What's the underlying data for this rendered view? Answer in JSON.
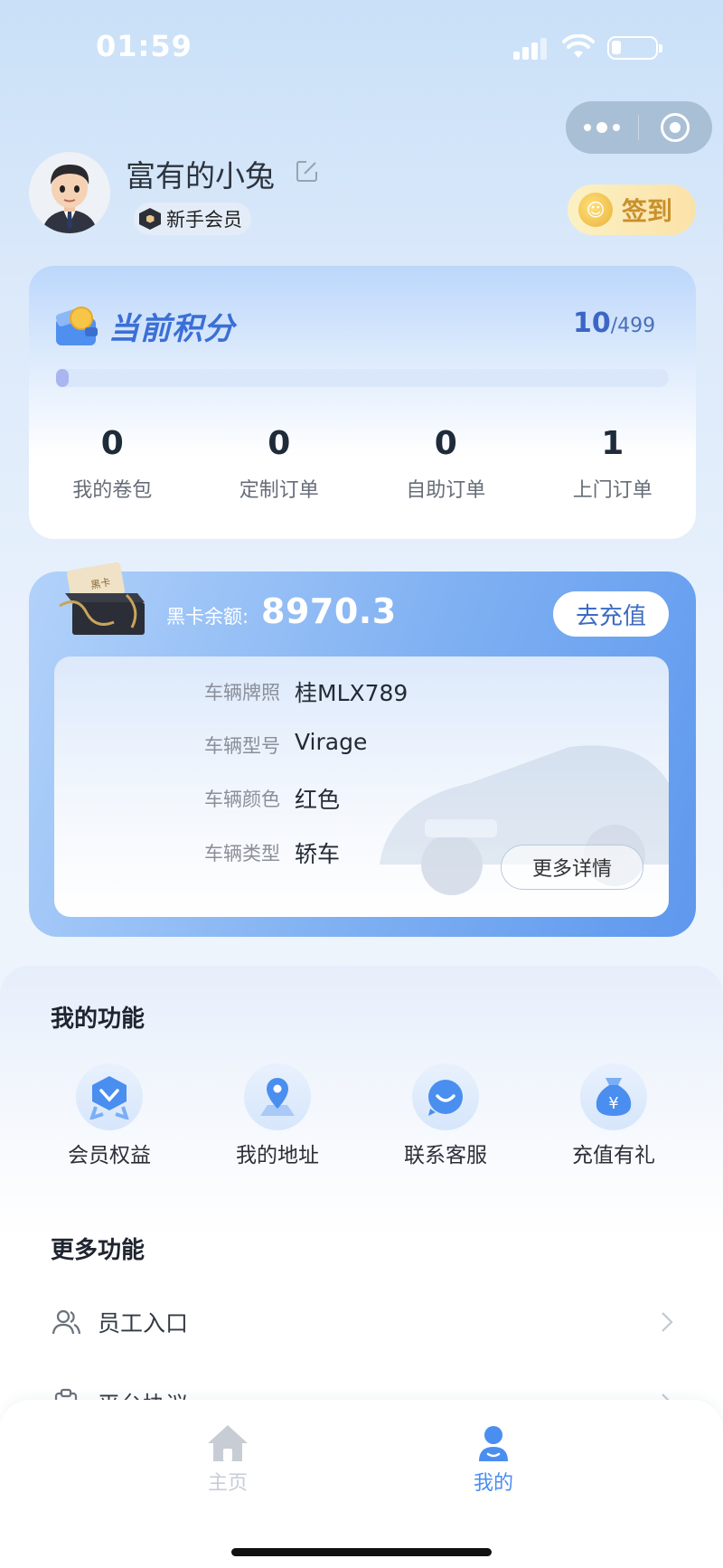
{
  "status_bar": {
    "time": "01:59"
  },
  "profile": {
    "username": "富有的小兔",
    "member_level": "新手会员",
    "signin_label": "签到"
  },
  "points": {
    "title": "当前积分",
    "current": "10",
    "target": "/499",
    "progress_fraction": 0.02,
    "stats": [
      {
        "value": "0",
        "label": "我的卷包"
      },
      {
        "value": "0",
        "label": "定制订单"
      },
      {
        "value": "0",
        "label": "自助订单"
      },
      {
        "value": "1",
        "label": "上门订单"
      }
    ]
  },
  "black_card": {
    "box_text": "黑卡",
    "balance_label": "黑卡余额:",
    "balance_value": "8970.3",
    "recharge_label": "去充值",
    "vehicle": [
      {
        "key": "车辆牌照",
        "value": "桂MLX789"
      },
      {
        "key": "车辆型号",
        "value": "Virage"
      },
      {
        "key": "车辆颜色",
        "value": "红色"
      },
      {
        "key": "车辆类型",
        "value": "轿车"
      }
    ],
    "more_label": "更多详情"
  },
  "my_functions": {
    "title": "我的功能",
    "items": [
      {
        "label": "会员权益",
        "icon": "member-benefits-icon"
      },
      {
        "label": "我的地址",
        "icon": "location-pin-icon"
      },
      {
        "label": "联系客服",
        "icon": "customer-service-icon"
      },
      {
        "label": "充值有礼",
        "icon": "money-bag-icon"
      }
    ]
  },
  "more_functions": {
    "title": "更多功能",
    "items": [
      {
        "label": "员工入口",
        "icon": "staff-icon"
      },
      {
        "label": "平台协议",
        "icon": "clipboard-icon"
      }
    ]
  },
  "tab_bar": {
    "items": [
      {
        "label": "主页",
        "icon": "home-icon",
        "active": false
      },
      {
        "label": "我的",
        "icon": "user-icon",
        "active": true
      }
    ],
    "active_color": "#4a8ef0",
    "inactive_color": "#c8cdd5"
  },
  "colors": {
    "accent": "#3b6fd6",
    "signin": "#c9902c"
  }
}
